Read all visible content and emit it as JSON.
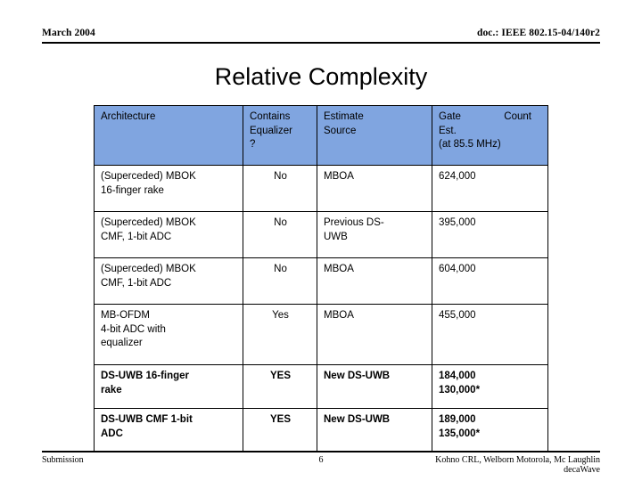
{
  "slide": {
    "header": {
      "left": "March 2004",
      "right": "doc.: IEEE 802.15-04/140r2"
    },
    "title": "Relative Complexity",
    "footer": {
      "left": "Submission",
      "page_number": "6",
      "right_line1": "Kohno CRL, Welborn Motorola, Mc Laughlin",
      "right_line2": "decaWave"
    }
  },
  "colors": {
    "header_row_background": "#80A5E0",
    "border": "#000000",
    "text": "#000000",
    "page_background": "#FFFFFF"
  },
  "table": {
    "columns": [
      {
        "label_line1": "Architecture",
        "label_line2": "",
        "label_line3": ""
      },
      {
        "label_line1": "Contains",
        "label_line2": "Equalizer",
        "label_line3": "?"
      },
      {
        "label_line1": "Estimate",
        "label_line2": "Source",
        "label_line3": ""
      },
      {
        "label_line1": "Gate      Count",
        "label_line2": "Est.",
        "label_line3": "(at 85.5 MHz)"
      }
    ],
    "rows": [
      {
        "architecture_line1": "(Superceded) MBOK",
        "architecture_line2": "16-finger rake",
        "architecture_line3": "",
        "contains_equalizer": "No",
        "estimate_source_line1": "MBOA",
        "estimate_source_line2": "",
        "gate_count_line1": "624,000",
        "gate_count_line2": "",
        "emphasis": false
      },
      {
        "architecture_line1": "(Superceded) MBOK",
        "architecture_line2": "CMF, 1-bit ADC",
        "architecture_line3": "",
        "contains_equalizer": "No",
        "estimate_source_line1": "Previous DS-",
        "estimate_source_line2": "UWB",
        "gate_count_line1": "395,000",
        "gate_count_line2": "",
        "emphasis": false
      },
      {
        "architecture_line1": "(Superceded) MBOK",
        "architecture_line2": "CMF, 1-bit ADC",
        "architecture_line3": "",
        "contains_equalizer": "No",
        "estimate_source_line1": "MBOA",
        "estimate_source_line2": "",
        "gate_count_line1": "604,000",
        "gate_count_line2": "",
        "emphasis": false
      },
      {
        "architecture_line1": "MB-OFDM",
        "architecture_line2": "4-bit ADC with",
        "architecture_line3": "equalizer",
        "contains_equalizer": "Yes",
        "estimate_source_line1": "MBOA",
        "estimate_source_line2": "",
        "gate_count_line1": "455,000",
        "gate_count_line2": "",
        "emphasis": false
      },
      {
        "architecture_line1": "DS-UWB 16-finger",
        "architecture_line2": "rake",
        "architecture_line3": "",
        "contains_equalizer": "YES",
        "estimate_source_line1": "New DS-UWB",
        "estimate_source_line2": "",
        "gate_count_line1": "184,000",
        "gate_count_line2": "130,000*",
        "emphasis": true
      },
      {
        "architecture_line1": "DS-UWB CMF 1-bit",
        "architecture_line2": "ADC",
        "architecture_line3": "",
        "contains_equalizer": "YES",
        "estimate_source_line1": "New DS-UWB",
        "estimate_source_line2": "",
        "gate_count_line1": "189,000",
        "gate_count_line2": "135,000*",
        "emphasis": true
      }
    ]
  }
}
